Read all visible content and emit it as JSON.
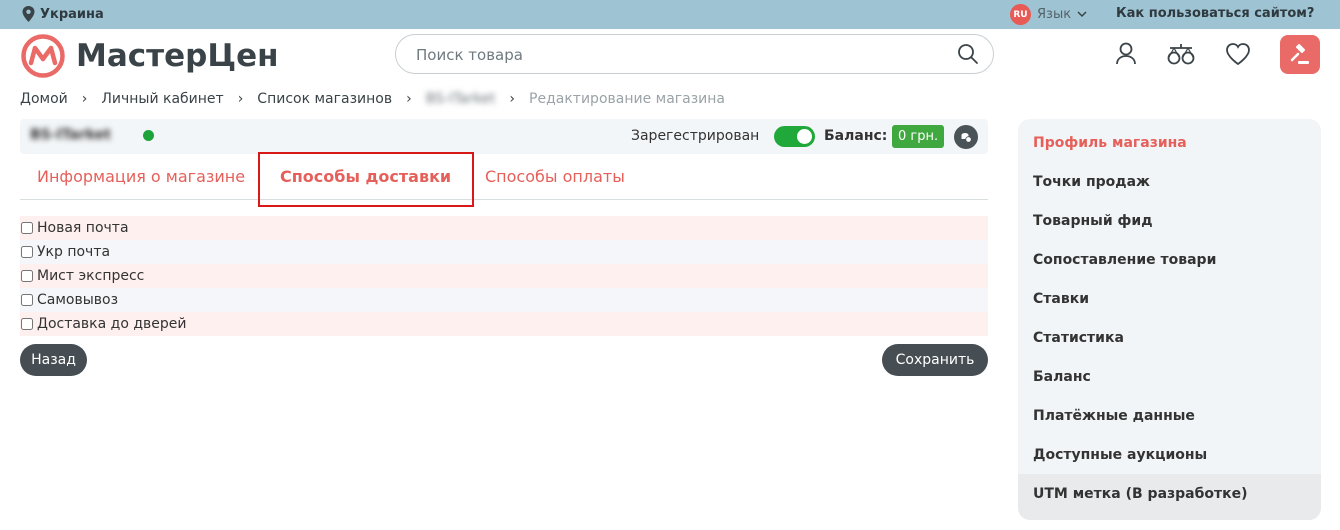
{
  "topbar": {
    "region": "Украина",
    "lang_code": "RU",
    "lang_label": "Язык",
    "howto": "Как пользоваться сайтом?"
  },
  "header": {
    "logo_text": "МастерЦен",
    "search_placeholder": "Поиск товара",
    "accent_color": "#e96a66"
  },
  "breadcrumbs": [
    "Домой",
    "Личный кабинет",
    "Список магазинов",
    "BS-ITarket",
    "Редактирование магазина"
  ],
  "shop": {
    "name": "BS-ITarket",
    "status_label": "Зарегестрирован",
    "balance_label": "Баланс:",
    "balance_value": "0 грн."
  },
  "tabs": [
    {
      "label": "Информация о магазине"
    },
    {
      "label": "Способы доставки"
    },
    {
      "label": "Способы оплаты"
    }
  ],
  "delivery_options": [
    {
      "label": "Новая почта"
    },
    {
      "label": "Укр почта"
    },
    {
      "label": "Мист экспресс"
    },
    {
      "label": "Самовывоз"
    },
    {
      "label": "Доставка до дверей"
    }
  ],
  "buttons": {
    "back": "Назад",
    "save": "Сохранить"
  },
  "sidebar": [
    {
      "label": "Профиль магазина"
    },
    {
      "label": "Точки продаж"
    },
    {
      "label": "Товарный фид"
    },
    {
      "label": "Сопоставление товари"
    },
    {
      "label": "Ставки"
    },
    {
      "label": "Статистика"
    },
    {
      "label": "Баланс"
    },
    {
      "label": "Платёжные данные"
    },
    {
      "label": "Доступные аукционы"
    },
    {
      "label": "UTM метка (В разработке)"
    }
  ]
}
